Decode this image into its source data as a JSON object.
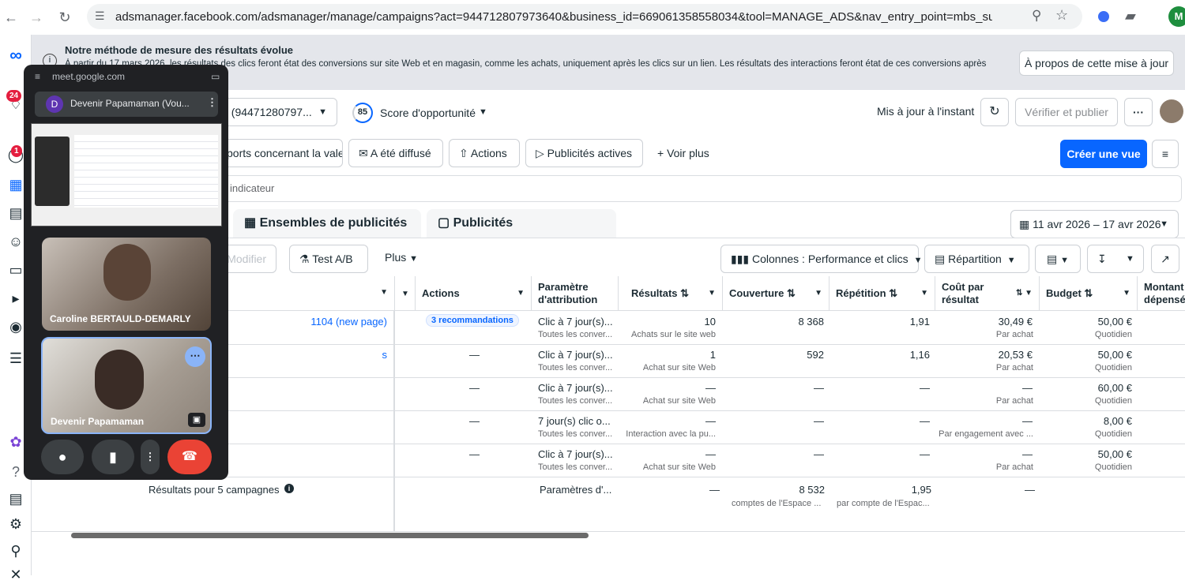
{
  "browser": {
    "url": "adsmanager.facebook.com/adsmanager/manage/campaigns?act=944712807973640&business_id=669061358558034&tool=MANAGE_ADS&nav_entry_point=mbs_sub_nav&nav_so...",
    "profile_initial": "M"
  },
  "rail": {
    "notif_badge": "24",
    "inbox_badge": "1"
  },
  "banner": {
    "title": "Notre méthode de mesure des résultats évolue",
    "body": "À partir du 17 mars 2026, les résultats des clics feront état des conversions sur site Web et en magasin, comme les achats, uniquement après les clics sur un lien. Les résultats des interactions feront état de ces conversions après toutes les",
    "button": "À propos de cette mise à jour"
  },
  "header": {
    "account": "t (94471280797...",
    "score_value": "85",
    "score_label": "Score d'opportunité",
    "updated": "Mis à jour à l'instant",
    "publish": "Vérifier et publier",
    "more": "···"
  },
  "views": {
    "items": [
      "ports concernant la valeur",
      "A été diffusé",
      "Actions",
      "Publicités actives"
    ],
    "see_more": "Voir plus",
    "create_view": "Créer une vue"
  },
  "search_placeholder": "indicateur",
  "tabs": {
    "adsets": "Ensembles de publicités",
    "ads": "Publicités"
  },
  "date_range": "11 avr 2026 – 17 avr 2026",
  "toolbar": {
    "edit": "Modifier",
    "ab_test": "Test A/B",
    "more": "Plus",
    "columns": "Colonnes : Performance et clics",
    "breakdown": "Répartition"
  },
  "table": {
    "headers": {
      "actions": "Actions",
      "attribution": [
        "Paramètre",
        "d'attribution"
      ],
      "results": "Résultats",
      "reach": "Couverture",
      "frequency": "Répétition",
      "cost": [
        "Coût par",
        "résultat"
      ],
      "budget": "Budget",
      "spent": [
        "Montant",
        "dépensé"
      ]
    },
    "rows": [
      {
        "name": "1104 (new page)",
        "actions": "3 recommandations",
        "attr": "Clic à 7 jour(s)...",
        "attr_sub": "Toutes les conver...",
        "results": "10",
        "results_sub": "Achats sur le site web",
        "reach": "8 368",
        "freq": "1,91",
        "cost": "30,49 €",
        "cost_sub": "Par achat",
        "budget": "50,00 €",
        "budget_sub": "Quotidien"
      },
      {
        "name": "s",
        "actions": "—",
        "attr": "Clic à 7 jour(s)...",
        "attr_sub": "Toutes les conver...",
        "results": "1",
        "results_sub": "Achat sur site Web",
        "reach": "592",
        "freq": "1,16",
        "cost": "20,53 €",
        "cost_sub": "Par achat",
        "budget": "50,00 €",
        "budget_sub": "Quotidien"
      },
      {
        "name": "",
        "actions": "—",
        "attr": "Clic à 7 jour(s)...",
        "attr_sub": "Toutes les conver...",
        "results": "—",
        "results_sub": "Achat sur site Web",
        "reach": "—",
        "freq": "—",
        "cost": "—",
        "cost_sub": "Par achat",
        "budget": "60,00 €",
        "budget_sub": "Quotidien"
      },
      {
        "name": "",
        "actions": "—",
        "attr": "7 jour(s) clic o...",
        "attr_sub": "Toutes les conver...",
        "results": "—",
        "results_sub": "Interaction avec la pu...",
        "reach": "—",
        "freq": "—",
        "cost": "—",
        "cost_sub": "Par engagement avec ...",
        "budget": "8,00 €",
        "budget_sub": "Quotidien"
      },
      {
        "name": "",
        "actions": "—",
        "attr": "Clic à 7 jour(s)...",
        "attr_sub": "Toutes les conver...",
        "results": "—",
        "results_sub": "Achat sur site Web",
        "reach": "—",
        "freq": "—",
        "cost": "—",
        "cost_sub": "Par achat",
        "budget": "50,00 €",
        "budget_sub": "Quotidien"
      }
    ],
    "summary": {
      "label": "Résultats pour 5 campagnes",
      "attr": "Paramètres d'...",
      "results": "—",
      "reach": "8 532",
      "reach_sub": "comptes de l'Espace ...",
      "freq": "1,95",
      "freq_sub": "par compte de l'Espac...",
      "cost": "—"
    }
  },
  "meet": {
    "origin": "meet.google.com",
    "meeting_initial": "D",
    "meeting_title": "Devenir Papamaman (Vou...",
    "participant1": "Caroline BERTAULD-DEMARLY",
    "participant2": "Devenir Papamaman"
  }
}
